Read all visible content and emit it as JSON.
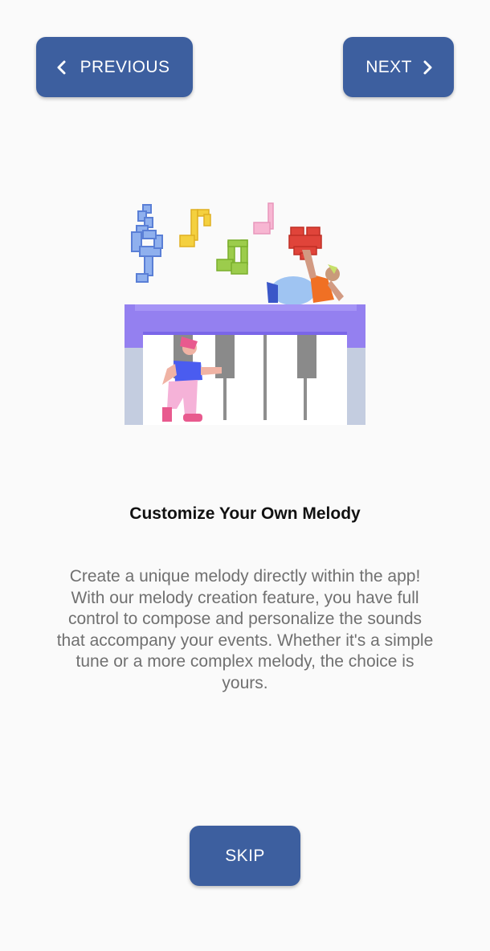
{
  "nav": {
    "previous_label": "PREVIOUS",
    "next_label": "NEXT",
    "skip_label": "SKIP"
  },
  "content": {
    "title": "Customize Your Own Melody",
    "description": "Create a unique melody directly within the app! With our melody creation feature, you have full control to compose and personalize the sounds that accompany your events. Whether it's a simple tune or a more complex melody, the choice is yours."
  },
  "icons": {
    "previous": "chevron-left-icon",
    "next": "chevron-right-icon",
    "illustration": "piano-music-illustration"
  },
  "colors": {
    "background": "#fafafa",
    "button": "#3d5f9f",
    "button_text": "#ffffff",
    "title": "#111111",
    "description": "#707070"
  }
}
